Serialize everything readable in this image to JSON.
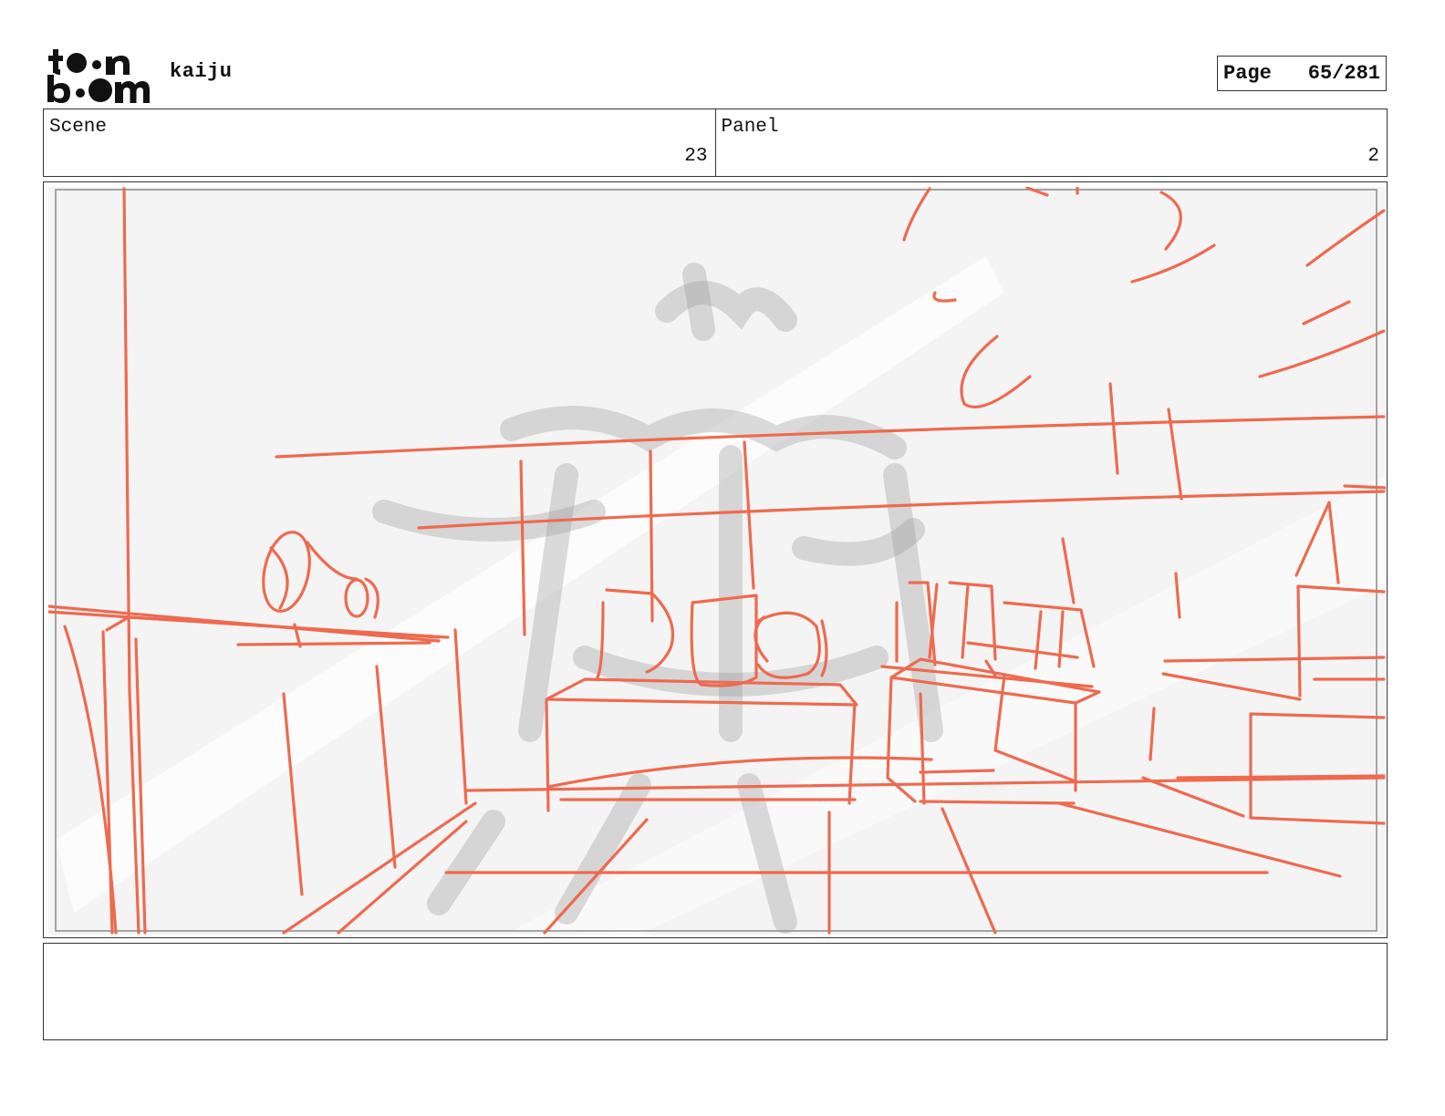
{
  "header": {
    "logo": {
      "text_top": "toon",
      "text_bottom": "boom"
    },
    "project_title": "kaiju",
    "page_label": "Page",
    "page_number": "65/281"
  },
  "scene": {
    "label": "Scene",
    "value": "23"
  },
  "panel": {
    "label": "Panel",
    "value": "2"
  },
  "sketch": {
    "stroke_color": "#ee6a4f",
    "watermark_color": "#9a9a9a"
  },
  "notes": {
    "text": ""
  }
}
